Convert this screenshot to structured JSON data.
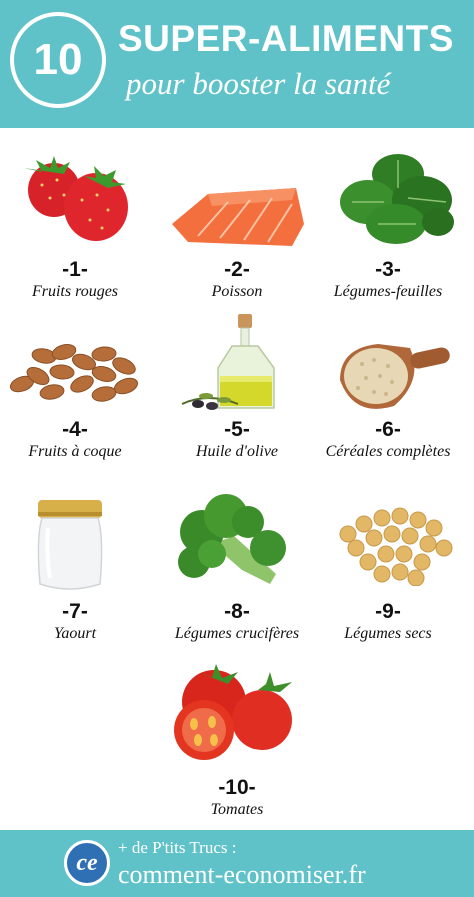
{
  "header": {
    "badge_number": "10",
    "title": "SUPER-ALIMENTS",
    "subtitle": "pour booster la santé"
  },
  "items": [
    {
      "number": "-1-",
      "label": "Fruits rouges",
      "icon": "strawberries-icon"
    },
    {
      "number": "-2-",
      "label": "Poisson",
      "icon": "salmon-icon"
    },
    {
      "number": "-3-",
      "label": "Légumes-feuilles",
      "icon": "spinach-icon"
    },
    {
      "number": "-4-",
      "label": "Fruits à coque",
      "icon": "almonds-icon"
    },
    {
      "number": "-5-",
      "label": "Huile d'olive",
      "icon": "olive-oil-icon"
    },
    {
      "number": "-6-",
      "label": "Céréales complètes",
      "icon": "grain-scoop-icon"
    },
    {
      "number": "-7-",
      "label": "Yaourt",
      "icon": "yogurt-jar-icon"
    },
    {
      "number": "-8-",
      "label": "Légumes crucifères",
      "icon": "broccoli-icon"
    },
    {
      "number": "-9-",
      "label": "Légumes secs",
      "icon": "chickpeas-icon"
    },
    {
      "number": "-10-",
      "label": "Tomates",
      "icon": "tomatoes-icon"
    }
  ],
  "footer": {
    "logo_text": "ce",
    "line1": "+ de P'tits Trucs :",
    "line2": "comment-economiser.fr"
  },
  "colors": {
    "accent": "#5fc2c8",
    "logo_blue": "#2f6fb3"
  }
}
